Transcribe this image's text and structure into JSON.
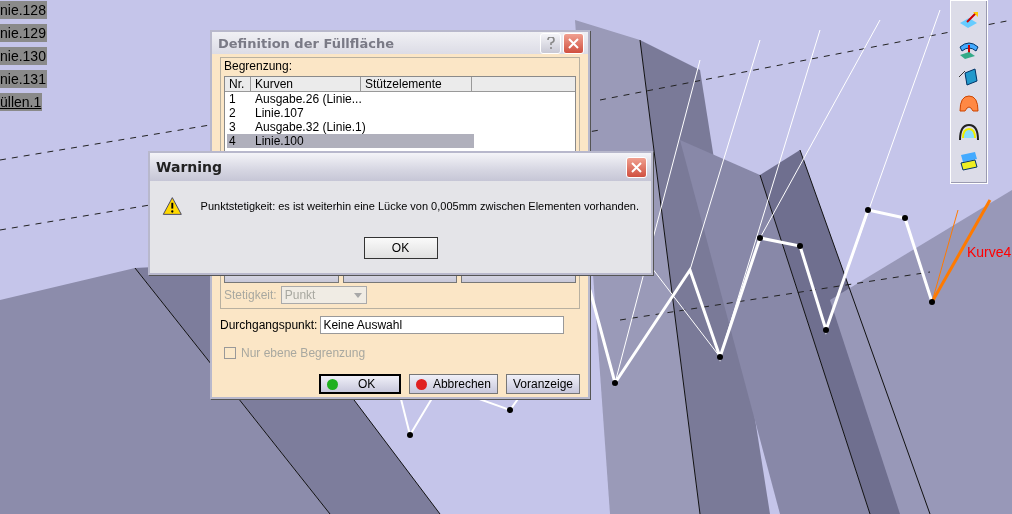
{
  "viewport": {
    "tree_items": [
      {
        "label": "nie.128",
        "current": false
      },
      {
        "label": "nie.129",
        "current": false
      },
      {
        "label": "nie.130",
        "current": false
      },
      {
        "label": "nie.131",
        "current": false
      },
      {
        "label": "üllen.1",
        "current": true
      }
    ],
    "curve_label": "Kurve4"
  },
  "fill_dialog": {
    "title": "Definition der Füllfläche",
    "group_label": "Begrenzung:",
    "columns": [
      "Nr.",
      "Kurven",
      "Stützelemente"
    ],
    "rows": [
      {
        "nr": "1",
        "curve": "Ausgabe.26 (Linie...",
        "selected": false
      },
      {
        "nr": "2",
        "curve": "Linie.107",
        "selected": false
      },
      {
        "nr": "3",
        "curve": "Ausgabe.32 (Linie.1)",
        "selected": false
      },
      {
        "nr": "4",
        "curve": "Linie.100",
        "selected": true
      }
    ],
    "continuity": {
      "label": "Stetigkeit:",
      "value": "Punkt",
      "disabled": true
    },
    "passing_point": {
      "label": "Durchgangspunkt:",
      "value": "Keine Auswahl"
    },
    "planar_only": {
      "label": "Nur ebene Begrenzung",
      "checked": false,
      "disabled": true
    },
    "buttons": [
      {
        "label": "OK",
        "kind": "ok"
      },
      {
        "label": "Abbrechen",
        "kind": "cancel"
      },
      {
        "label": "Voranzeige",
        "kind": "plain"
      }
    ]
  },
  "warning": {
    "title": "Warning",
    "message": "Punktstetigkeit: es ist weiterhin eine Lücke von 0,005mm zwischen Elementen vorhanden.",
    "button": "OK"
  }
}
